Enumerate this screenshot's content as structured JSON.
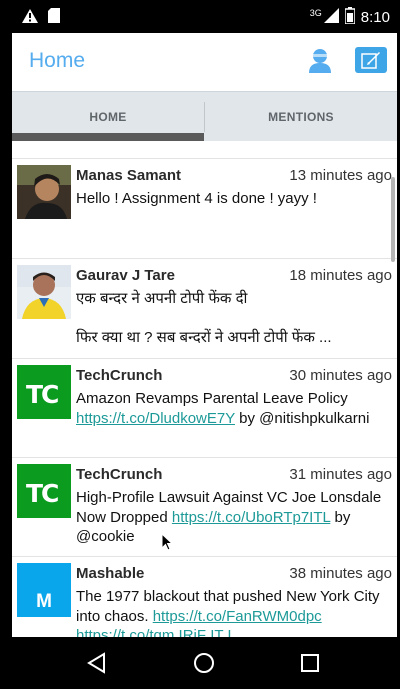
{
  "status_bar": {
    "time": "8:10",
    "network": "3G"
  },
  "app_bar": {
    "title": "Home",
    "accent": "#55acee"
  },
  "tabs": [
    {
      "label": "HOME",
      "selected": true
    },
    {
      "label": "MENTIONS",
      "selected": false
    }
  ],
  "tweets": [
    {
      "name": "Manas Samant",
      "time": "13 minutes ago",
      "text": "Hello ! Assignment 4 is done ! yayy !"
    },
    {
      "name": "Gaurav J Tare",
      "time": "18 minutes ago",
      "line1": "एक बन्दर ने अपनी टोपी फेंक दी",
      "line2": "फिर क्या था ? सब बन्दरों ने अपनी टोपी फेंक ..."
    },
    {
      "name": "TechCrunch",
      "time": "30 minutes ago",
      "text_before": "Amazon Revamps Parental Leave Policy ",
      "link": "https://t.co/DludkowE7Y",
      "text_after": " by @nitishpkulkarni"
    },
    {
      "name": "TechCrunch",
      "time": "31 minutes ago",
      "text_before": "High-Profile Lawsuit Against VC Joe Lonsdale Now Dropped ",
      "link": "https://t.co/UboRTp7ITL",
      "text_after": " by @cookie"
    },
    {
      "name": "Mashable",
      "time": "38 minutes ago",
      "text_before": "The 1977 blackout that pushed New York City into chaos. ",
      "link": "https://t.co/FanRWM0dpc",
      "link2": "https://t.co/tqm IRiF IT I"
    }
  ],
  "avatar_labels": {
    "techcrunch": "TC",
    "mashable": "M"
  }
}
